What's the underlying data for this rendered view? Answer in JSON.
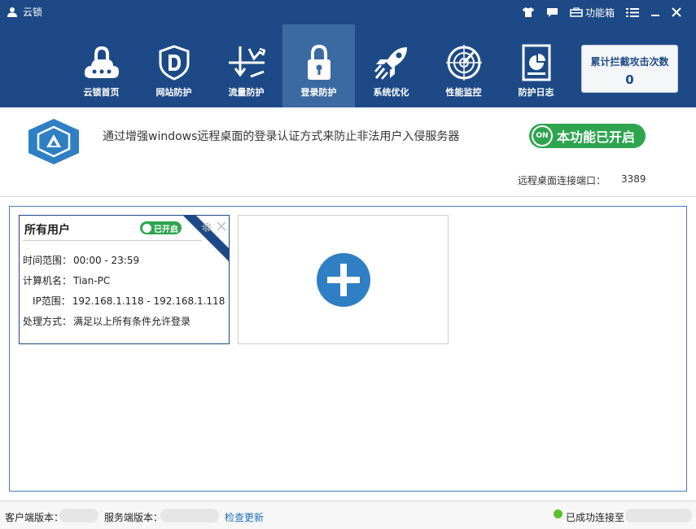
{
  "window": {
    "title": "云锁",
    "toolbox_label": "功能箱"
  },
  "nav": {
    "items": [
      {
        "label": "云锁首页",
        "icon": "cloud-lock-icon"
      },
      {
        "label": "网站防护",
        "icon": "shield-d-icon"
      },
      {
        "label": "流量防护",
        "icon": "traffic-icon"
      },
      {
        "label": "登录防护",
        "icon": "padlock-icon",
        "active": true
      },
      {
        "label": "系统优化",
        "icon": "rocket-icon"
      },
      {
        "label": "性能监控",
        "icon": "radar-icon"
      },
      {
        "label": "防护日志",
        "icon": "log-chart-icon"
      }
    ]
  },
  "counter": {
    "label": "累计拦截攻击次数",
    "value": "0"
  },
  "info": {
    "description": "通过增强windows远程桌面的登录认证方式来防止非法用户入侵服务器",
    "status_on": "ON",
    "status_text": "本功能已开启",
    "port_label": "远程桌面连接端口：",
    "port_value": "3389"
  },
  "rule_card": {
    "title": "所有用户",
    "badge": "已开启",
    "rows": [
      {
        "key": "时间范围：",
        "value": "00:00 - 23:59"
      },
      {
        "key": "计算机名：",
        "value": "Tian-PC"
      },
      {
        "key": "IP范围：",
        "value": "192.168.1.118 - 192.168.1.118"
      },
      {
        "key": "处理方式：",
        "value": "满足以上所有条件允许登录"
      }
    ]
  },
  "footer": {
    "client_version_label": "客户端版本：",
    "server_version_label": "服务端版本：",
    "check_update": "检查更新",
    "connected_label": "已成功连接至"
  },
  "colors": {
    "header_bg": "#1d4a86",
    "active_tab_bg": "#3b6aa3",
    "success_green": "#2ea44f",
    "add_button_blue": "#2f7fc4"
  }
}
